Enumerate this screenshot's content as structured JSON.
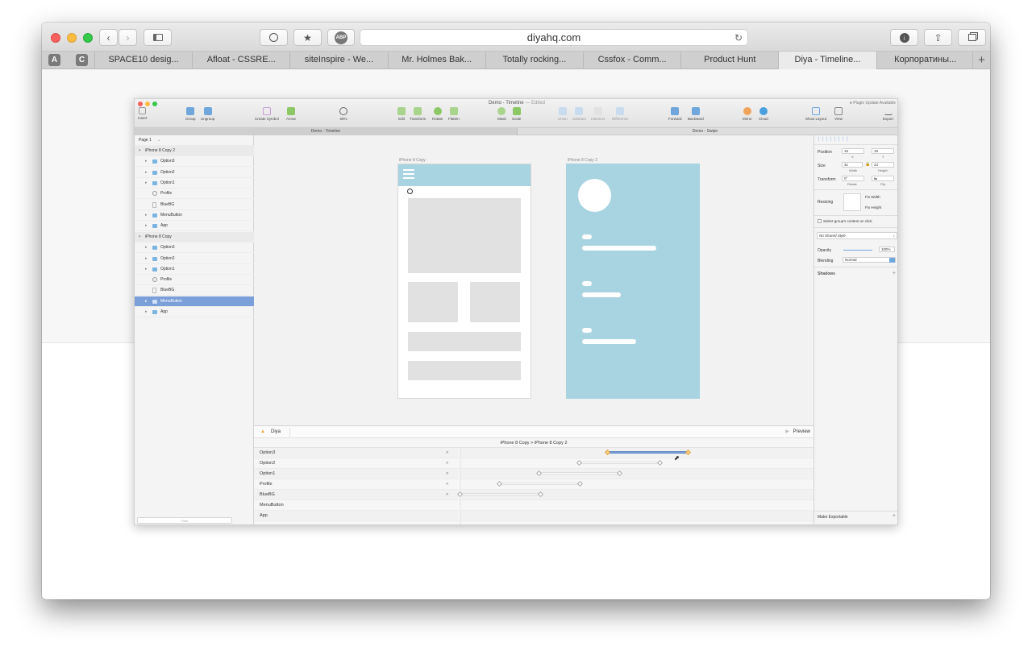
{
  "browser": {
    "url": "diyahq.com",
    "pinned": [
      "A",
      "C"
    ],
    "tabs": [
      {
        "label": "SPACE10 desig..."
      },
      {
        "label": "Afloat - CSSRE..."
      },
      {
        "label": "siteInspire - We..."
      },
      {
        "label": "Mr. Holmes Bak..."
      },
      {
        "label": "Totally rocking..."
      },
      {
        "label": "Cssfox - Comm..."
      },
      {
        "label": "Product Hunt"
      },
      {
        "label": "Diya - Timeline..."
      },
      {
        "label": "Корпоратины..."
      }
    ],
    "active_tab_index": 7,
    "adblock_label": "ABP"
  },
  "sketch": {
    "title": "Demo - Timeline",
    "title_suffix": "— Edited",
    "plugin_notice": "● Plugin Update Available",
    "toolbar": {
      "insert": "Insert",
      "group": "Group",
      "ungroup": "Ungroup",
      "create_symbol": "Create Symbol",
      "arrow": "Arrow",
      "zoom": "69%",
      "edit": "Edit",
      "transform": "Transform",
      "rotate": "Rotate",
      "flatten": "Flatten",
      "mask": "Mask",
      "scale": "Scale",
      "union": "Union",
      "subtract": "Subtract",
      "intersect": "Intersect",
      "difference": "Difference",
      "forward": "Forward",
      "backward": "Backward",
      "mirror": "Mirror",
      "cloud": "Cloud",
      "show_layout": "Show Layout",
      "view": "View",
      "export": "Export"
    },
    "doc_tabs": [
      "Demo - Timeline",
      "Demo - Swipe"
    ],
    "page": "Page 1",
    "layers": [
      {
        "label": "iPhone 8 Copy 2",
        "kind": "group"
      },
      {
        "label": "Option3",
        "kind": "folder"
      },
      {
        "label": "Option2",
        "kind": "folder"
      },
      {
        "label": "Option1",
        "kind": "folder"
      },
      {
        "label": "Profile",
        "kind": "oval"
      },
      {
        "label": "BlueBG",
        "kind": "rect"
      },
      {
        "label": "MenuButton",
        "kind": "folder"
      },
      {
        "label": "App",
        "kind": "folder"
      },
      {
        "label": "iPhone 8 Copy",
        "kind": "group"
      },
      {
        "label": "Option3",
        "kind": "folder"
      },
      {
        "label": "Option2",
        "kind": "folder"
      },
      {
        "label": "Option1",
        "kind": "folder"
      },
      {
        "label": "Profile",
        "kind": "oval"
      },
      {
        "label": "BlueBG",
        "kind": "rect"
      },
      {
        "label": "MenuButton",
        "kind": "folder",
        "selected": true
      },
      {
        "label": "App",
        "kind": "folder"
      }
    ],
    "filter_placeholder": "Filter",
    "artboards": [
      "iPhone 8 Copy",
      "iPhone 8 Copy 2"
    ],
    "inspector": {
      "position_label": "Position",
      "position_x": "15",
      "position_y": "18",
      "x_label": "X",
      "y_label": "Y",
      "size_label": "Size",
      "width": "31",
      "height": "24",
      "width_label": "Width",
      "height_label": "Height",
      "transform_label": "Transform",
      "rotate_value": "0°",
      "rotate_label": "Rotate",
      "flip_label": "Flip",
      "resizing_label": "Resizing",
      "fix_width": "Fix Width",
      "fix_height": "Fix Height",
      "select_group": "Select group's content on click",
      "shared_style": "No Shared Style",
      "opacity_label": "Opacity",
      "opacity_value": "100%",
      "opacity": 1.0,
      "blending_label": "Blending",
      "blending_value": "Normal",
      "shadows_label": "Shadows",
      "make_exportable": "Make Exportable"
    },
    "timeline": {
      "plugin_name": "Diya",
      "preview": "Preview",
      "breadcrumb_from": "iPhone 8 Copy",
      "breadcrumb_to": "iPhone 8 Copy 2",
      "rows": [
        {
          "label": "Option3",
          "chevron": ">"
        },
        {
          "label": "Option2",
          "chevron": ">"
        },
        {
          "label": "Option1",
          "chevron": ">"
        },
        {
          "label": "Profile",
          "chevron": ">"
        },
        {
          "label": "BlueBG",
          "chevron": ">"
        },
        {
          "label": "MenuButton",
          "chevron": ""
        },
        {
          "label": "App",
          "chevron": ""
        }
      ]
    }
  },
  "colors": {
    "selection": "#7b9fd8",
    "artboard_blue": "#a8d3e0",
    "traffic_red": "#fc605c",
    "traffic_yellow": "#fdbc40",
    "traffic_green": "#34c84a"
  }
}
